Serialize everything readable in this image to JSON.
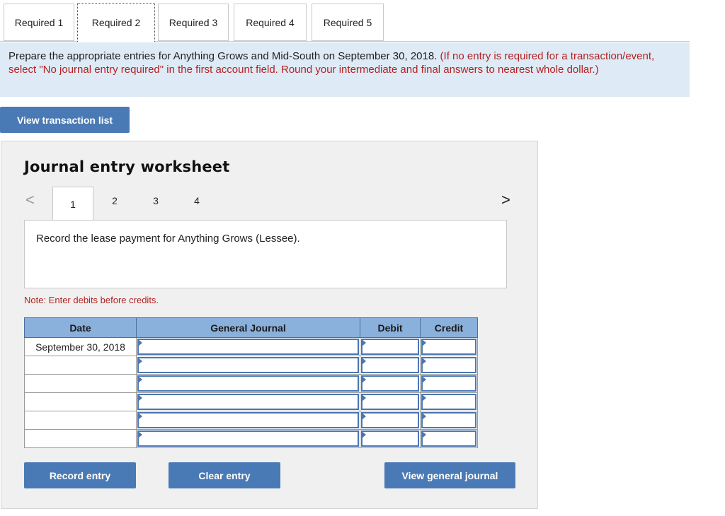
{
  "tabs": [
    "Required 1",
    "Required 2",
    "Required 3",
    "Required 4",
    "Required 5"
  ],
  "active_tab": "Required 2",
  "instruction": {
    "main": "Prepare the appropriate entries for Anything Grows and Mid-South on September 30, 2018.",
    "note": "(If no entry is required for a transaction/event, select \"No journal entry required\" in the first account field. Round your intermediate and final answers to nearest whole dollar.)"
  },
  "view_transaction_list": "View transaction list",
  "worksheet": {
    "title": "Journal entry worksheet",
    "prev_icon": "<",
    "next_icon": ">",
    "pages": [
      "1",
      "2",
      "3",
      "4"
    ],
    "current_page": "1",
    "prompt": "Record the lease payment for Anything Grows (Lessee).",
    "note": "Note: Enter debits before credits."
  },
  "journal": {
    "headers": [
      "Date",
      "General Journal",
      "Debit",
      "Credit"
    ],
    "rows": [
      {
        "date": "September 30, 2018",
        "account": "",
        "debit": "",
        "credit": ""
      },
      {
        "date": "",
        "account": "",
        "debit": "",
        "credit": ""
      },
      {
        "date": "",
        "account": "",
        "debit": "",
        "credit": ""
      },
      {
        "date": "",
        "account": "",
        "debit": "",
        "credit": ""
      },
      {
        "date": "",
        "account": "",
        "debit": "",
        "credit": ""
      },
      {
        "date": "",
        "account": "",
        "debit": "",
        "credit": ""
      }
    ]
  },
  "buttons": {
    "record": "Record entry",
    "clear": "Clear entry",
    "view_general_journal": "View general journal"
  },
  "colors": {
    "button_blue": "#4a7ab5",
    "banner_bg": "#deeaf6",
    "header_blue": "#8ab0dc",
    "note_red": "#b22222"
  }
}
